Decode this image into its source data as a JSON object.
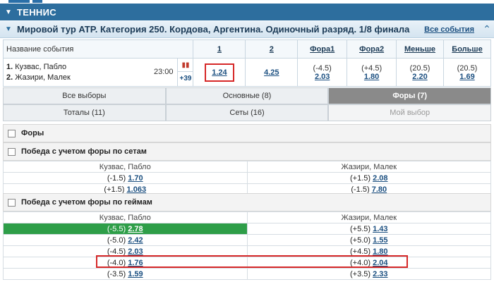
{
  "sport": {
    "title": "ТЕННИС"
  },
  "event": {
    "title": "Мировой тур ATP. Категория 250. Кордова, Аргентина. Одиночный разряд. 1/8 финала",
    "all_events": "Все события"
  },
  "odds_table": {
    "headers": {
      "name": "Название события",
      "c1": "1",
      "c2": "2",
      "f1": "Фора1",
      "f2": "Фора2",
      "under": "Меньше",
      "over": "Больше"
    },
    "player1_num": "1.",
    "player1": "Кузвас, Пабло",
    "player2_num": "2.",
    "player2": "Жазири, Малек",
    "time": "23:00",
    "more": "+39",
    "c1": "1.24",
    "c2": "4.25",
    "f1_param": "(-4.5)",
    "f1": "2.03",
    "f2_param": "(+4.5)",
    "f2": "1.80",
    "under_param": "(20.5)",
    "under": "2.20",
    "over_param": "(20.5)",
    "over": "1.69"
  },
  "tabs": {
    "all": "Все выборы",
    "main": "Основные (8)",
    "handicaps": "Форы (7)",
    "totals": "Тоталы (11)",
    "sets": "Сеты (16)",
    "my": "Мой выбор"
  },
  "sections": {
    "handicaps": "Форы",
    "sets_hcp": "Победа с учетом форы по сетам",
    "games_hcp": "Победа с учетом форы по геймам"
  },
  "sets_market": {
    "p1": "Кузвас, Пабло",
    "p2": "Жазири, Малек",
    "rows": [
      {
        "p1_param": "(-1.5)",
        "p1_coef": "1.70",
        "p2_param": "(+1.5)",
        "p2_coef": "2.08"
      },
      {
        "p1_param": "(+1.5)",
        "p1_coef": "1.063",
        "p2_param": "(-1.5)",
        "p2_coef": "7.80"
      }
    ]
  },
  "games_market": {
    "p1": "Кузвас, Пабло",
    "p2": "Жазири, Малек",
    "rows": [
      {
        "p1_param": "(-5.5)",
        "p1_coef": "2.78",
        "p2_param": "(+5.5)",
        "p2_coef": "1.43"
      },
      {
        "p1_param": "(-5.0)",
        "p1_coef": "2.42",
        "p2_param": "(+5.0)",
        "p2_coef": "1.55"
      },
      {
        "p1_param": "(-4.5)",
        "p1_coef": "2.03",
        "p2_param": "(+4.5)",
        "p2_coef": "1.80"
      },
      {
        "p1_param": "(-4.0)",
        "p1_coef": "1.76",
        "p2_param": "(+4.0)",
        "p2_coef": "2.04"
      },
      {
        "p1_param": "(-3.5)",
        "p1_coef": "1.59",
        "p2_param": "(+3.5)",
        "p2_coef": "2.33"
      }
    ]
  },
  "colors": {
    "header": "#2d6e9e",
    "active_tab": "#8a8a8a",
    "highlight": "#2e9e48",
    "annotation": "#d62828"
  }
}
